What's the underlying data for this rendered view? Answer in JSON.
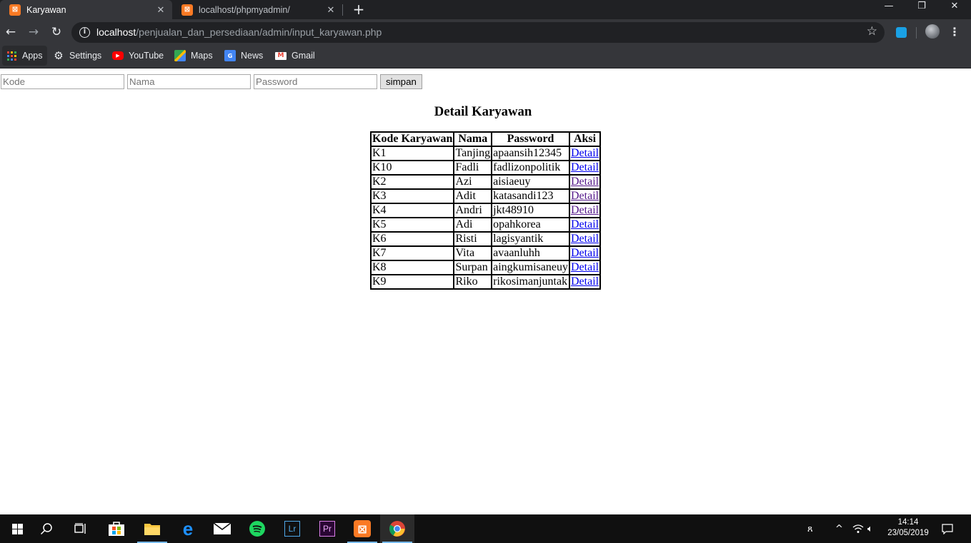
{
  "browser": {
    "tabs": [
      {
        "title": "Karyawan",
        "active": true,
        "favicon": "xampp-icon"
      },
      {
        "title": "localhost/phpmyadmin/",
        "active": false,
        "favicon": "xampp-icon"
      }
    ],
    "new_tab_label": "+",
    "window_controls": {
      "minimize": "—",
      "restore": "❐",
      "close": "✕"
    },
    "toolbar": {
      "back": "←",
      "forward": "→",
      "reload": "↻",
      "menu": "⋮",
      "bookmark_star": "☆"
    },
    "address_bar": {
      "host": "localhost",
      "path": "/penjualan_dan_persediaan/admin/input_karyawan.php"
    },
    "bookmarks": [
      {
        "label": "Apps",
        "icon": "apps-grid-icon"
      },
      {
        "label": "Settings",
        "icon": "gear-icon"
      },
      {
        "label": "YouTube",
        "icon": "youtube-icon"
      },
      {
        "label": "Maps",
        "icon": "maps-icon"
      },
      {
        "label": "News",
        "icon": "news-icon"
      },
      {
        "label": "Gmail",
        "icon": "gmail-icon"
      }
    ]
  },
  "form": {
    "kode_placeholder": "Kode",
    "nama_placeholder": "Nama",
    "password_placeholder": "Password",
    "submit_label": "simpan"
  },
  "page": {
    "heading": "Detail Karyawan"
  },
  "table": {
    "headers": [
      "Kode Karyawan",
      "Nama",
      "Password",
      "Aksi"
    ],
    "rows": [
      {
        "kode": "K1",
        "nama": "Tanjing",
        "password": "apaansih12345",
        "aksi": "Detail",
        "visited": false
      },
      {
        "kode": "K10",
        "nama": "Fadli",
        "password": "fadlizonpolitik",
        "aksi": "Detail",
        "visited": false
      },
      {
        "kode": "K2",
        "nama": "Azi",
        "password": "aisiaeuy",
        "aksi": "Detail",
        "visited": true
      },
      {
        "kode": "K3",
        "nama": "Adit",
        "password": "katasandi123",
        "aksi": "Detail",
        "visited": true
      },
      {
        "kode": "K4",
        "nama": "Andri",
        "password": "jkt48910",
        "aksi": "Detail",
        "visited": true
      },
      {
        "kode": "K5",
        "nama": "Adi",
        "password": "opahkorea",
        "aksi": "Detail",
        "visited": false
      },
      {
        "kode": "K6",
        "nama": "Risti",
        "password": "lagisyantik",
        "aksi": "Detail",
        "visited": false
      },
      {
        "kode": "K7",
        "nama": "Vita",
        "password": "avaanluhh",
        "aksi": "Detail",
        "visited": false
      },
      {
        "kode": "K8",
        "nama": "Surpan",
        "password": "aingkumisaneuy",
        "aksi": "Detail",
        "visited": false
      },
      {
        "kode": "K9",
        "nama": "Riko",
        "password": "rikosimanjuntak",
        "aksi": "Detail",
        "visited": false
      }
    ]
  },
  "taskbar": {
    "apps": [
      {
        "name": "start-button",
        "icon": "windows-logo-icon"
      },
      {
        "name": "search-button",
        "icon": "search-icon"
      },
      {
        "name": "task-view-button",
        "icon": "task-view-icon"
      },
      {
        "name": "store-app",
        "icon": "store-icon"
      },
      {
        "name": "file-explorer-app",
        "icon": "folder-icon"
      },
      {
        "name": "edge-app",
        "icon": "edge-icon"
      },
      {
        "name": "mail-app",
        "icon": "mail-icon"
      },
      {
        "name": "spotify-app",
        "icon": "spotify-icon"
      },
      {
        "name": "lightroom-app",
        "icon": "lightroom-icon",
        "label": "Lr"
      },
      {
        "name": "premiere-app",
        "icon": "premiere-icon",
        "label": "Pr"
      },
      {
        "name": "xampp-app",
        "icon": "xampp-icon"
      },
      {
        "name": "chrome-app",
        "icon": "chrome-icon"
      }
    ],
    "clock": {
      "time": "14:14",
      "date": "23/05/2019"
    }
  },
  "colors": {
    "tabstrip_bg": "#202124",
    "toolbar_bg": "#35363a",
    "link": "#0000ee",
    "link_visited": "#551a8b",
    "taskbar_bg": "#101010"
  }
}
